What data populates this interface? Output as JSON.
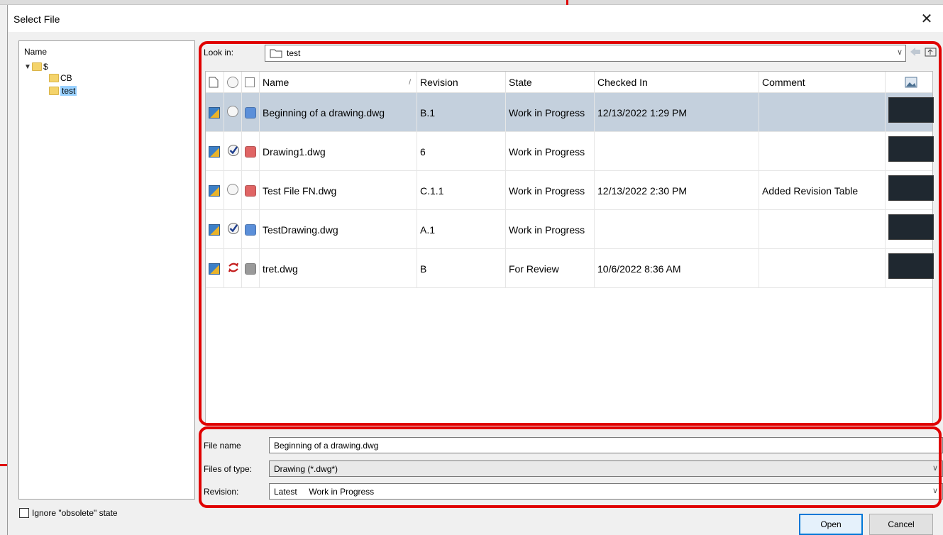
{
  "window": {
    "title": "Select File",
    "close_glyph": "✕"
  },
  "tree": {
    "header": "Name",
    "root": "$",
    "children": [
      "CB",
      "test"
    ],
    "selected": "test"
  },
  "ignore_obsolete_label": "Ignore \"obsolete\" state",
  "look_in": {
    "label": "Look in:",
    "value": "test"
  },
  "grid": {
    "columns": [
      "Name",
      "Revision",
      "State",
      "Checked In",
      "Comment"
    ],
    "sort_indicator": "/",
    "rows": [
      {
        "name": "Beginning of a drawing.dwg",
        "revision": "B.1",
        "state": "Work in Progress",
        "checked_in": "12/13/2022 1:29 PM",
        "comment": "",
        "status_icon": "radio-empty-icon",
        "state_color": "#5b8fd9",
        "selected": true
      },
      {
        "name": "Drawing1.dwg",
        "revision": "6",
        "state": "Work in Progress",
        "checked_in": "",
        "comment": "",
        "status_icon": "checked-out-icon",
        "state_color": "#e06565",
        "selected": false
      },
      {
        "name": "Test File FN.dwg",
        "revision": "C.1.1",
        "state": "Work in Progress",
        "checked_in": "12/13/2022 2:30 PM",
        "comment": "Added Revision Table",
        "status_icon": "radio-empty-icon",
        "state_color": "#e06565",
        "selected": false
      },
      {
        "name": "TestDrawing.dwg",
        "revision": "A.1",
        "state": "Work in Progress",
        "checked_in": "",
        "comment": "",
        "status_icon": "checked-out-icon",
        "state_color": "#5b8fd9",
        "selected": false
      },
      {
        "name": "tret.dwg",
        "revision": "B",
        "state": "For Review",
        "checked_in": "10/6/2022 8:36 AM",
        "comment": "",
        "status_icon": "sync-icon",
        "state_color": "#9a9a9a",
        "selected": false
      }
    ]
  },
  "fields": {
    "file_name_label": "File name",
    "file_name_value": "Beginning of a drawing.dwg",
    "files_of_type_label": "Files of type:",
    "files_of_type_value": "Drawing (*.dwg*)",
    "revision_label": "Revision:",
    "revision_value": "Latest     Work in Progress"
  },
  "buttons": {
    "open": "Open",
    "cancel": "Cancel"
  },
  "colors": {
    "annotation": "#e00000",
    "selection": "#c4d0dd",
    "tree_selection": "#99d1ff"
  }
}
